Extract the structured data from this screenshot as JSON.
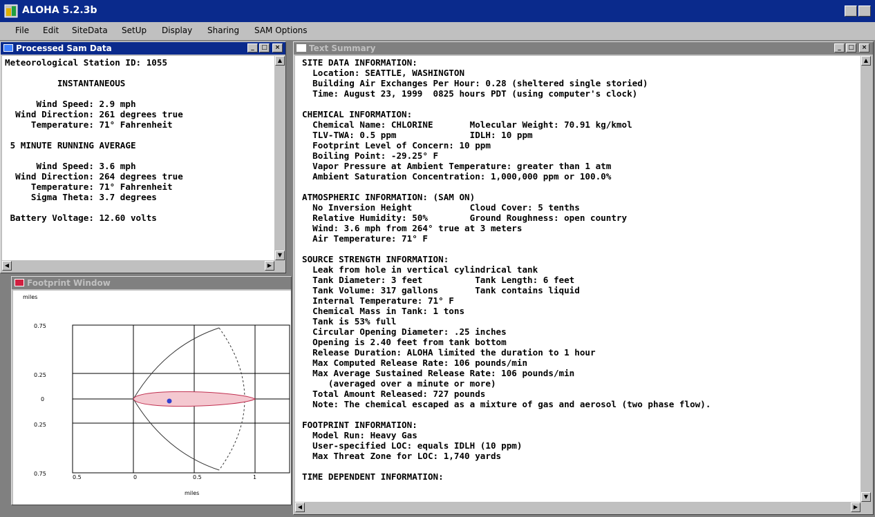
{
  "app": {
    "title": "ALOHA 5.2.3b",
    "menus": [
      "File",
      "Edit",
      "SiteData",
      "SetUp",
      "Display",
      "Sharing",
      "SAM Options"
    ]
  },
  "sam_window": {
    "title": "Processed Sam Data",
    "lines": [
      "Meteorological Station ID: 1055",
      "",
      "          INSTANTANEOUS",
      "",
      "      Wind Speed: 2.9 mph",
      "  Wind Direction: 261 degrees true",
      "     Temperature: 71° Fahrenheit",
      "",
      " 5 MINUTE RUNNING AVERAGE",
      "",
      "      Wind Speed: 3.6 mph",
      "  Wind Direction: 264 degrees true",
      "     Temperature: 71° Fahrenheit",
      "     Sigma Theta: 3.7 degrees",
      "",
      " Battery Voltage: 12.60 volts"
    ]
  },
  "footprint_window": {
    "title": "Footprint Window",
    "unit_top": "miles",
    "unit_bottom": "miles",
    "y_ticks": [
      "0.75",
      "0.25",
      "0",
      "0.25",
      "0.75"
    ],
    "x_ticks": [
      "0.5",
      "0",
      "0.5",
      "1"
    ]
  },
  "text_window": {
    "title": "Text Summary",
    "lines": [
      "SITE DATA INFORMATION:",
      "  Location: SEATTLE, WASHINGTON",
      "  Building Air Exchanges Per Hour: 0.28 (sheltered single storied)",
      "  Time: August 23, 1999  0825 hours PDT (using computer's clock)",
      "",
      "CHEMICAL INFORMATION:",
      "  Chemical Name: CHLORINE       Molecular Weight: 70.91 kg/kmol",
      "  TLV-TWA: 0.5 ppm              IDLH: 10 ppm",
      "  Footprint Level of Concern: 10 ppm",
      "  Boiling Point: -29.25° F",
      "  Vapor Pressure at Ambient Temperature: greater than 1 atm",
      "  Ambient Saturation Concentration: 1,000,000 ppm or 100.0%",
      "",
      "ATMOSPHERIC INFORMATION: (SAM ON)",
      "  No Inversion Height           Cloud Cover: 5 tenths",
      "  Relative Humidity: 50%        Ground Roughness: open country",
      "  Wind: 3.6 mph from 264° true at 3 meters",
      "  Air Temperature: 71° F",
      "",
      "SOURCE STRENGTH INFORMATION:",
      "  Leak from hole in vertical cylindrical tank",
      "  Tank Diameter: 3 feet          Tank Length: 6 feet",
      "  Tank Volume: 317 gallons       Tank contains liquid",
      "  Internal Temperature: 71° F",
      "  Chemical Mass in Tank: 1 tons",
      "  Tank is 53% full",
      "  Circular Opening Diameter: .25 inches",
      "  Opening is 2.40 feet from tank bottom",
      "  Release Duration: ALOHA limited the duration to 1 hour",
      "  Max Computed Release Rate: 106 pounds/min",
      "  Max Average Sustained Release Rate: 106 pounds/min",
      "     (averaged over a minute or more)",
      "  Total Amount Released: 727 pounds",
      "  Note: The chemical escaped as a mixture of gas and aerosol (two phase flow).",
      "",
      "FOOTPRINT INFORMATION:",
      "  Model Run: Heavy Gas",
      "  User-specified LOC: equals IDLH (10 ppm)",
      "  Max Threat Zone for LOC: 1,740 yards",
      "",
      "TIME DEPENDENT INFORMATION:"
    ]
  }
}
